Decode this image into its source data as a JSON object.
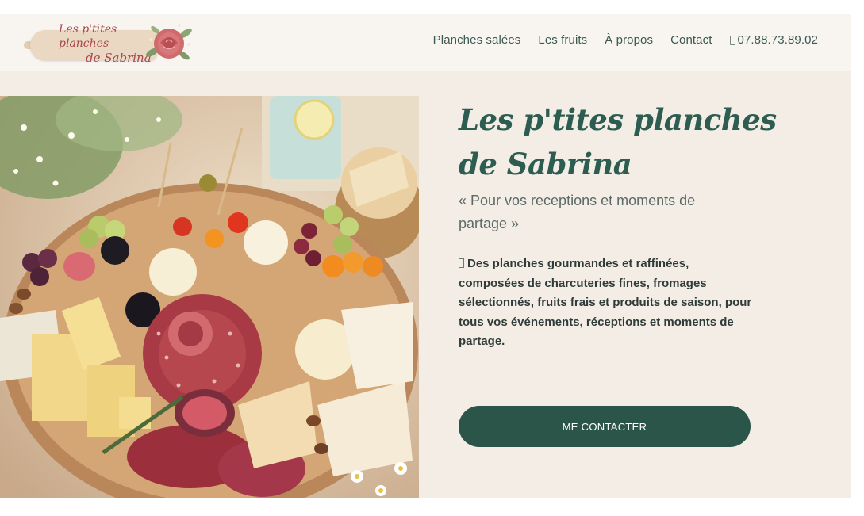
{
  "brand": {
    "logo_line1": "Les p'tites planches",
    "logo_line2": "de Sabrina"
  },
  "nav": {
    "items": [
      {
        "label": "Planches salées"
      },
      {
        "label": "Les fruits"
      },
      {
        "label": "À propos"
      },
      {
        "label": "Contact"
      }
    ],
    "phone": "07.88.73.89.02",
    "phone_icon": "phone-icon"
  },
  "hero": {
    "title_line1": "Les p'tites planches",
    "title_line2": "de Sabrina",
    "tagline": "« Pour vos receptions et moments de partage »",
    "description": "Des planches gourmandes et raffinées, composées de charcuteries fines, fromages sélectionnés, fruits frais et produits de saison, pour tous vos événements, réceptions et moments de partage.",
    "cta_label": "ME CONTACTER"
  },
  "colors": {
    "accent": "#2a5548",
    "title": "#2d5d51",
    "logo": "#a7464e",
    "background": "#f3ede6",
    "header": "#f8f4f0"
  }
}
